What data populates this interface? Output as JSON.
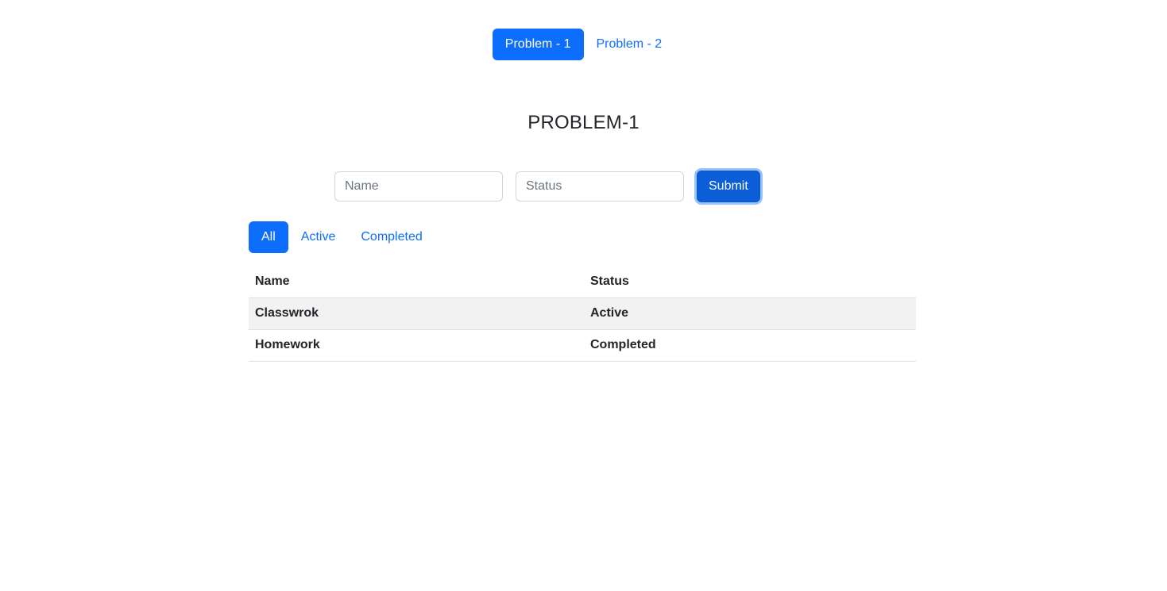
{
  "nav": {
    "tabs": [
      {
        "label": "Problem - 1",
        "active": true
      },
      {
        "label": "Problem - 2",
        "active": false
      }
    ]
  },
  "page": {
    "title": "PROBLEM-1"
  },
  "form": {
    "name_placeholder": "Name",
    "name_value": "",
    "status_placeholder": "Status",
    "status_value": "",
    "submit_label": "Submit"
  },
  "filters": {
    "items": [
      {
        "label": "All",
        "active": true
      },
      {
        "label": "Active",
        "active": false
      },
      {
        "label": "Completed",
        "active": false
      }
    ]
  },
  "table": {
    "headers": [
      "Name",
      "Status"
    ],
    "rows": [
      [
        "Classwrok",
        "Active"
      ],
      [
        "Homework",
        "Completed"
      ]
    ]
  },
  "colors": {
    "primary": "#0d6efd",
    "submit": "#0b5ed7",
    "striped_row": "#f2f2f2"
  }
}
